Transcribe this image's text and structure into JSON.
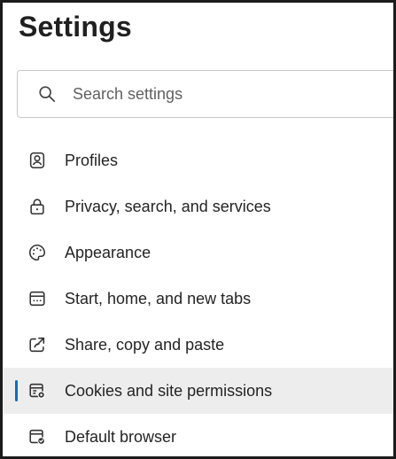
{
  "page": {
    "title": "Settings"
  },
  "search": {
    "placeholder": "Search settings",
    "icon": "search-icon"
  },
  "theme": {
    "accent": "#0f6cbd",
    "selected_background": "#ededed",
    "text": "#242424"
  },
  "nav": {
    "selected_index": 6,
    "items": [
      {
        "label": "Profiles",
        "icon": "profile-icon"
      },
      {
        "label": "Privacy, search, and services",
        "icon": "lock-icon"
      },
      {
        "label": "Appearance",
        "icon": "palette-icon"
      },
      {
        "label": "Start, home, and new tabs",
        "icon": "tabs-icon"
      },
      {
        "label": "Share, copy and paste",
        "icon": "share-icon"
      },
      {
        "label": "Cookies and site permissions",
        "icon": "cookies-site-permissions-icon"
      },
      {
        "label": "Default browser",
        "icon": "default-browser-icon"
      }
    ]
  }
}
